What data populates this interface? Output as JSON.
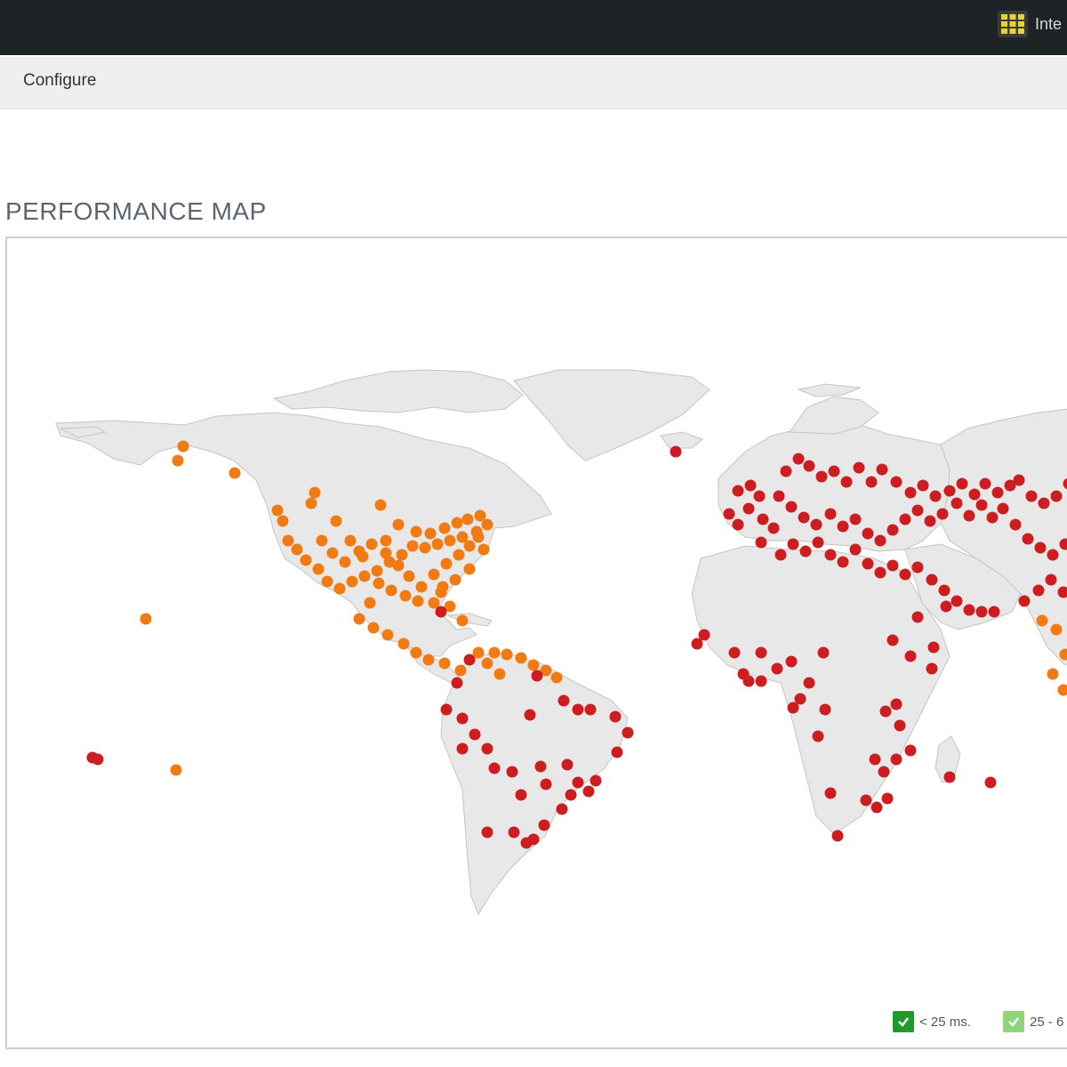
{
  "header": {
    "apps_icon": "grid-icon",
    "label": "Inte"
  },
  "subnav": {
    "configure": "Configure"
  },
  "page": {
    "title": "PERFORMANCE MAP"
  },
  "colors": {
    "topbar": "#1e2326",
    "land": "#e8e8e8",
    "good": "#f07b12",
    "poor": "#cc1d20",
    "legend_fast": "#1f9a2c",
    "legend_medium": "#8fd37a"
  },
  "legend": [
    {
      "label": "< 25 ms.",
      "color": "#1f9a2c",
      "checked": true
    },
    {
      "label": "25 - 6",
      "color": "#8fd37a",
      "checked": true
    }
  ]
}
